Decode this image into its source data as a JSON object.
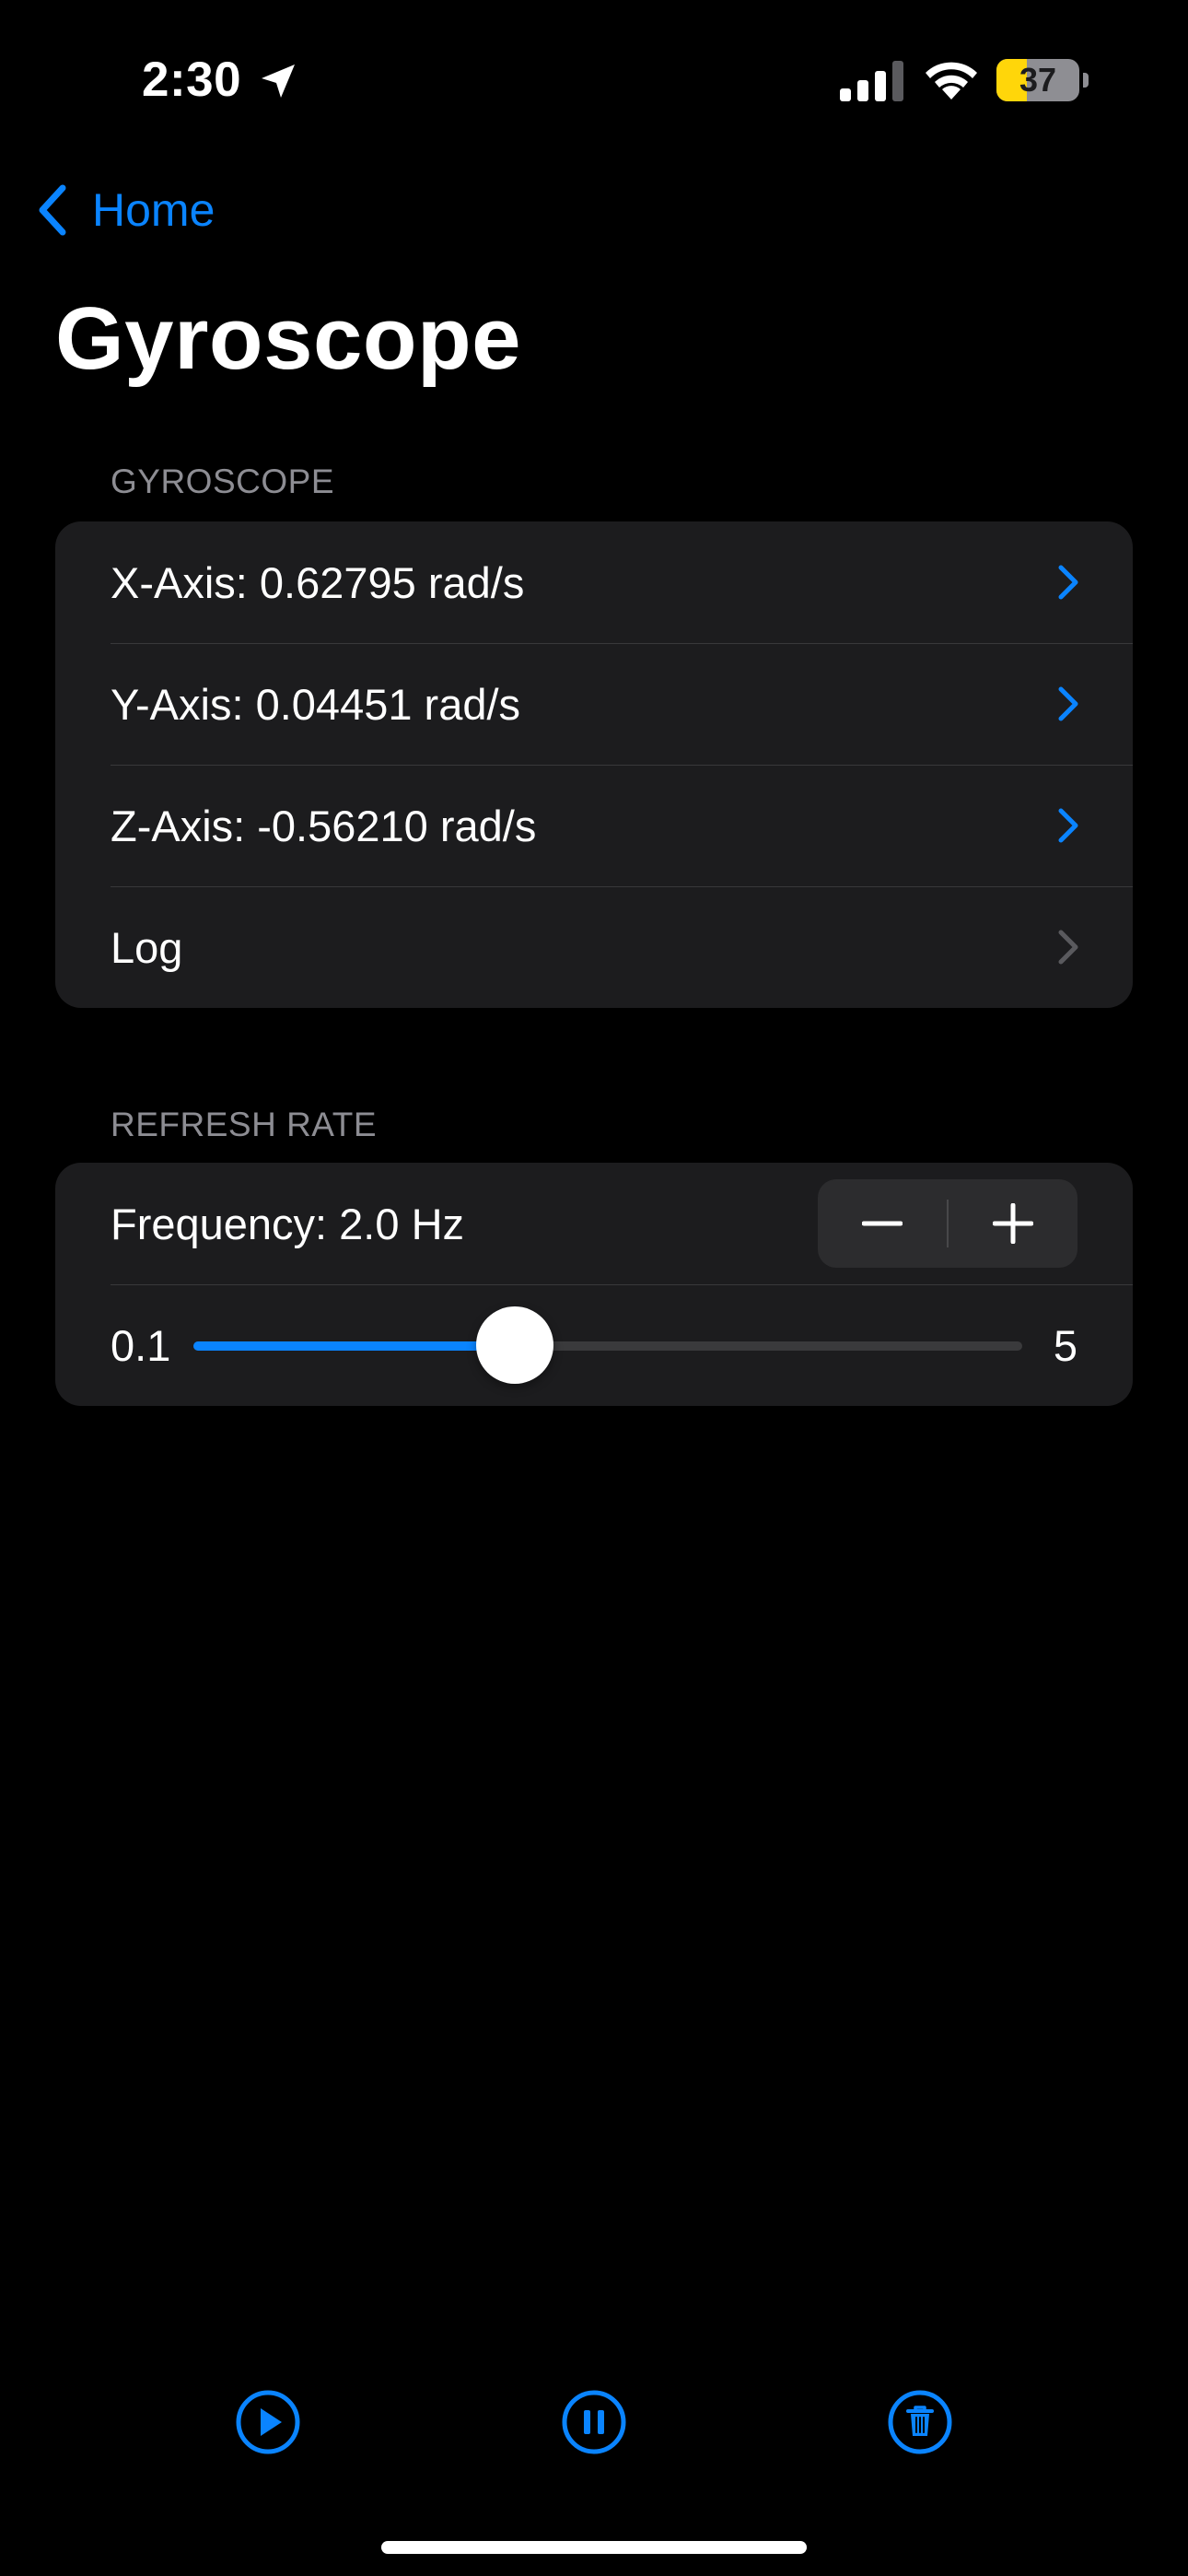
{
  "status_bar": {
    "time": "2:30",
    "battery_level": "37",
    "battery_fraction": 0.37,
    "icons": [
      "location-arrow-icon",
      "cellular-signal-icon",
      "wifi-icon",
      "battery-icon"
    ]
  },
  "nav": {
    "back_label": "Home",
    "title": "Gyroscope"
  },
  "gyroscope_section": {
    "header": "GYROSCOPE",
    "rows": [
      {
        "label": "X-Axis: 0.62795 rad/s"
      },
      {
        "label": "Y-Axis: 0.04451 rad/s"
      },
      {
        "label": "Z-Axis: -0.56210 rad/s"
      },
      {
        "label": "Log"
      }
    ]
  },
  "refresh_section": {
    "header": "REFRESH RATE",
    "frequency_label": "Frequency: 2.0 Hz",
    "slider": {
      "min_label": "0.1",
      "max_label": "5",
      "min": 0.1,
      "max": 5,
      "value": 2.0
    }
  },
  "toolbar": {
    "buttons": [
      "play-icon",
      "pause-icon",
      "trash-icon"
    ]
  },
  "colors": {
    "accent": "#0a84ff",
    "background": "#000000",
    "card": "#1c1c1e",
    "secondary_text": "#8d8d93",
    "battery_low_power": "#ffd60a"
  }
}
